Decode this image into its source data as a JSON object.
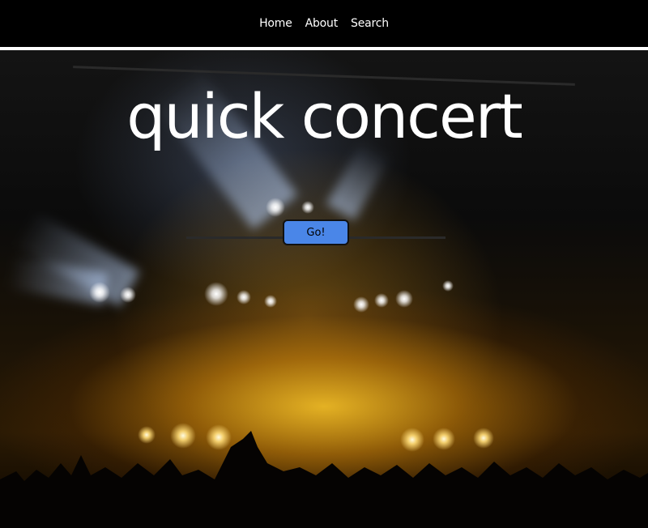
{
  "nav": {
    "items": [
      {
        "label": "Home"
      },
      {
        "label": "About"
      },
      {
        "label": "Search"
      }
    ]
  },
  "hero": {
    "title": "quick concert",
    "button_label": "Go!",
    "background_image": "concert-crowd-photo"
  },
  "colors": {
    "nav_background": "#000000",
    "nav_text": "#ffffff",
    "button_background": "#4a86e8",
    "title_text": "#ffffff"
  }
}
